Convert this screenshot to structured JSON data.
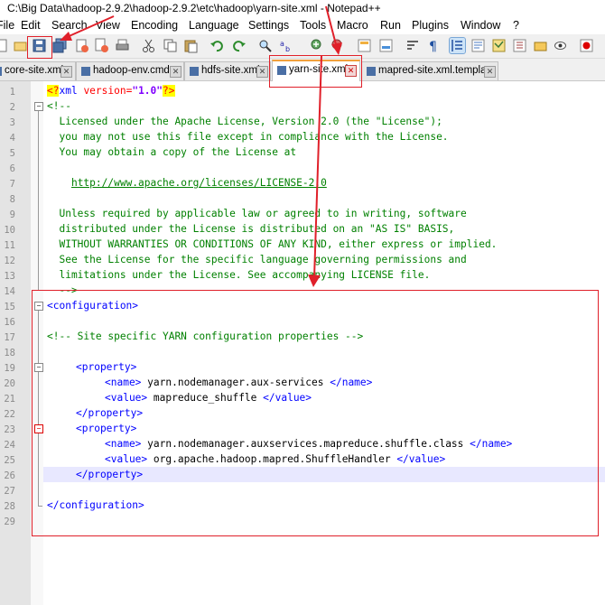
{
  "window": {
    "title": "C:\\Big Data\\hadoop-2.9.2\\hadoop-2.9.2\\etc\\hadoop\\yarn-site.xml - Notepad++"
  },
  "menu": [
    "File",
    "Edit",
    "Search",
    "View",
    "Encoding",
    "Language",
    "Settings",
    "Tools",
    "Macro",
    "Run",
    "Plugins",
    "Window",
    "?"
  ],
  "toolbar": {
    "icons": [
      "new-file-icon",
      "open-file-icon",
      "save-icon",
      "save-all-icon",
      "close-icon",
      "close-all-icon",
      "print-icon",
      "cut-icon",
      "copy-icon",
      "paste-icon",
      "undo-icon",
      "redo-icon",
      "find-icon",
      "replace-icon",
      "zoom-in-icon",
      "zoom-out-icon",
      "sync-vertical-icon",
      "sync-horizontal-icon",
      "word-wrap-icon",
      "show-all-chars-icon",
      "indent-guide-icon",
      "udl-icon",
      "doc-map-icon",
      "function-list-icon",
      "folder-workspace-icon",
      "monitor-icon",
      "record-macro-icon"
    ]
  },
  "tabs": [
    {
      "label": "core-site.xml",
      "active": false
    },
    {
      "label": "hadoop-env.cmd",
      "active": false
    },
    {
      "label": "hdfs-site.xml",
      "active": false
    },
    {
      "label": "yarn-site.xml",
      "active": true
    },
    {
      "label": "mapred-site.xml.template",
      "active": false
    }
  ],
  "line_numbers": [
    "1",
    "2",
    "3",
    "4",
    "5",
    "6",
    "7",
    "8",
    "9",
    "10",
    "11",
    "12",
    "13",
    "14",
    "15",
    "16",
    "17",
    "18",
    "19",
    "20",
    "21",
    "22",
    "23",
    "24",
    "25",
    "26",
    "27",
    "28",
    "29"
  ],
  "code": {
    "l1": {
      "pi_open": "<?",
      "name": "xml",
      "attr": " version=",
      "val": "\"1.0\"",
      "pi_close": "?>"
    },
    "l2": "<!--",
    "l3": "  Licensed under the Apache License, Version 2.0 (the \"License\");",
    "l4": "  you may not use this file except in compliance with the License.",
    "l5": "  You may obtain a copy of the License at",
    "l7_pre": "    ",
    "l7_link": "http://www.apache.org/licenses/LICENSE-2.0",
    "l9": "  Unless required by applicable law or agreed to in writing, software",
    "l10": "  distributed under the License is distributed on an \"AS IS\" BASIS,",
    "l11": "  WITHOUT WARRANTIES OR CONDITIONS OF ANY KIND, either express or implied.",
    "l12": "  See the License for the specific language governing permissions and",
    "l13": "  limitations under the License. See accompanying LICENSE file.",
    "l14": "  -->",
    "l15": "<configuration>",
    "l17": "<!-- Site specific YARN configuration properties -->",
    "l19": "<property>",
    "l20_open": "<name>",
    "l20_text": " yarn.nodemanager.aux-services ",
    "l20_close": "</name>",
    "l21_open": "<value>",
    "l21_text": " mapreduce_shuffle ",
    "l21_close": "</value>",
    "l22": "</property>",
    "l23": "<property>",
    "l24_open": "<name>",
    "l24_text": " yarn.nodemanager.auxservices.mapreduce.shuffle.class ",
    "l24_close": "</name>",
    "l25_open": "<value>",
    "l25_text": " org.apache.hadoop.mapred.ShuffleHandler ",
    "l25_close": "</value>",
    "l26": "</property>",
    "l28": "</configuration>"
  },
  "colors": {
    "comment": "#008000",
    "tag": "#0000ff",
    "highlight_box": "#e0202a",
    "active_tab_accent": "#f1a13c"
  }
}
